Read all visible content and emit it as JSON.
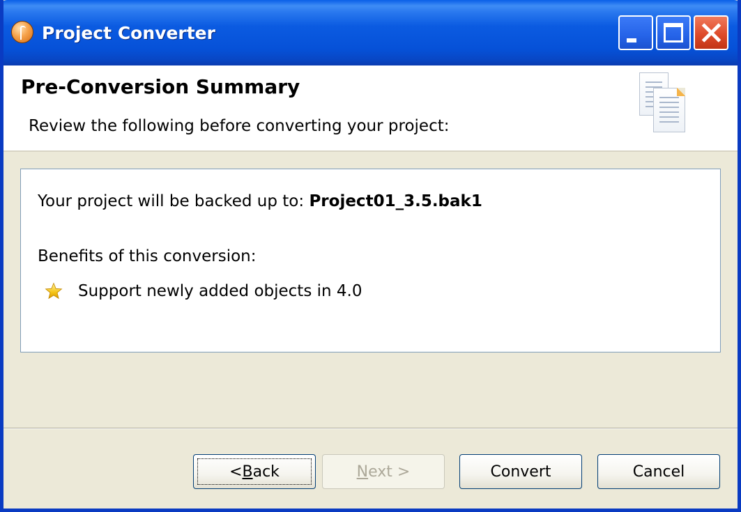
{
  "window": {
    "title": "Project Converter"
  },
  "header": {
    "title": "Pre-Conversion Summary",
    "description": "Review the following before converting your project:",
    "icon": "documents-icon"
  },
  "summary": {
    "backup_prefix": "Your project will be backed up to:",
    "backup_name": "Project01_3.5.bak1",
    "benefits_heading": "Benefits of this conversion:",
    "benefits": [
      {
        "icon": "star-icon",
        "text": "Support newly added objects in 4.0"
      }
    ]
  },
  "buttons": {
    "back": {
      "prefix": "< ",
      "mnemonic": "B",
      "rest": "ack"
    },
    "next": {
      "mnemonic": "N",
      "rest": "ext >",
      "enabled": false
    },
    "convert": "Convert",
    "cancel": "Cancel"
  },
  "colors": {
    "titlebar": "#0a5fe8",
    "window_bg": "#ece9d8",
    "close_button": "#de4b2a",
    "star": "#f5c518"
  }
}
